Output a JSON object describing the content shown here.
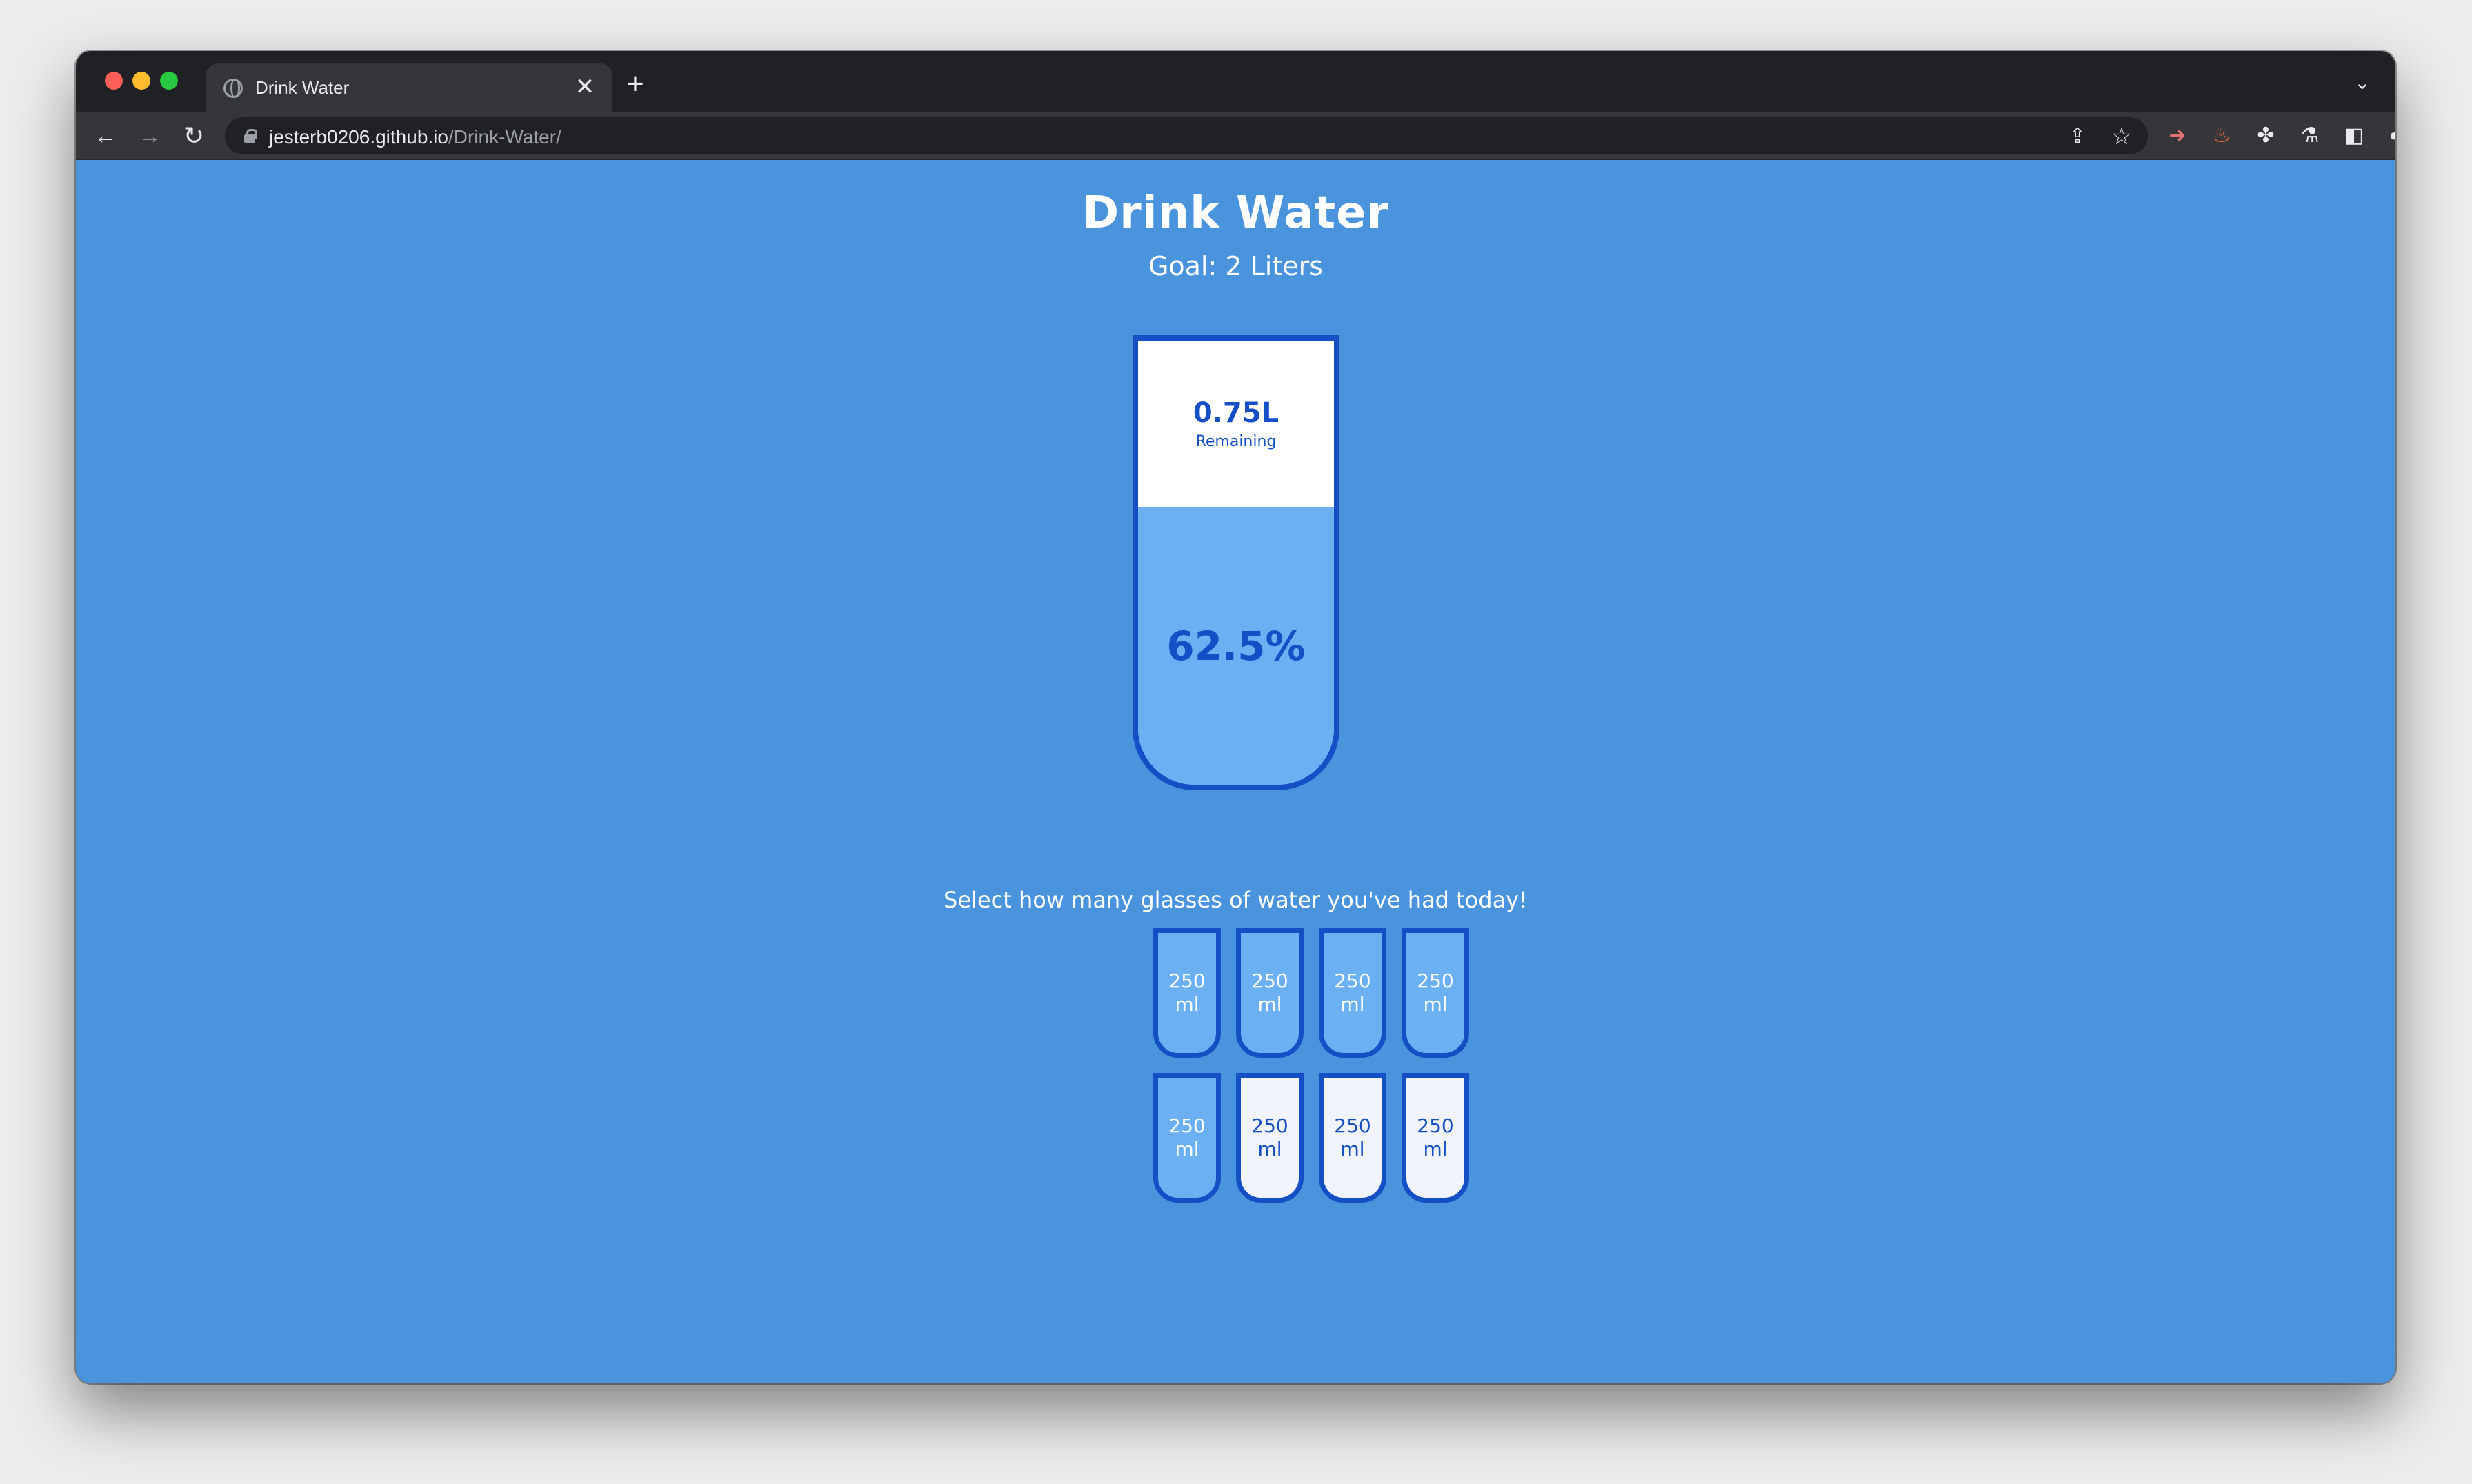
{
  "browser": {
    "tab_title": "Drink Water",
    "tab_close": "✕",
    "new_tab": "+",
    "url_host": "jesterb0206.github.io",
    "url_path": "/Drink-Water/"
  },
  "page": {
    "title": "Drink Water",
    "goal": "Goal: 2 Liters",
    "remained_value": "0.75L",
    "remained_label": "Remaining",
    "percentage": "62.5%",
    "fill_fraction": 0.625,
    "instruction": "Select how many glasses of water you've had today!",
    "cups": [
      {
        "amount": "250",
        "unit": "ml",
        "full": true
      },
      {
        "amount": "250",
        "unit": "ml",
        "full": true
      },
      {
        "amount": "250",
        "unit": "ml",
        "full": true
      },
      {
        "amount": "250",
        "unit": "ml",
        "full": true
      },
      {
        "amount": "250",
        "unit": "ml",
        "full": true
      },
      {
        "amount": "250",
        "unit": "ml",
        "full": false
      },
      {
        "amount": "250",
        "unit": "ml",
        "full": false
      },
      {
        "amount": "250",
        "unit": "ml",
        "full": false
      }
    ]
  },
  "colors": {
    "background": "#4a93dd",
    "cup_border": "#144fc6",
    "water": "#6ab0f2",
    "empty_cup": "#f1f4fc"
  },
  "icons": {
    "back": "arrow-left-icon",
    "forward": "arrow-right-icon",
    "reload": "reload-icon",
    "lock": "lock-icon",
    "share": "share-icon",
    "star": "star-icon",
    "extensions": [
      "tag-extension-icon",
      "fire-extension-icon",
      "puzzle-icon",
      "labs-flask-icon",
      "side-panel-icon",
      "profile-icon",
      "menu-dots-icon"
    ]
  }
}
